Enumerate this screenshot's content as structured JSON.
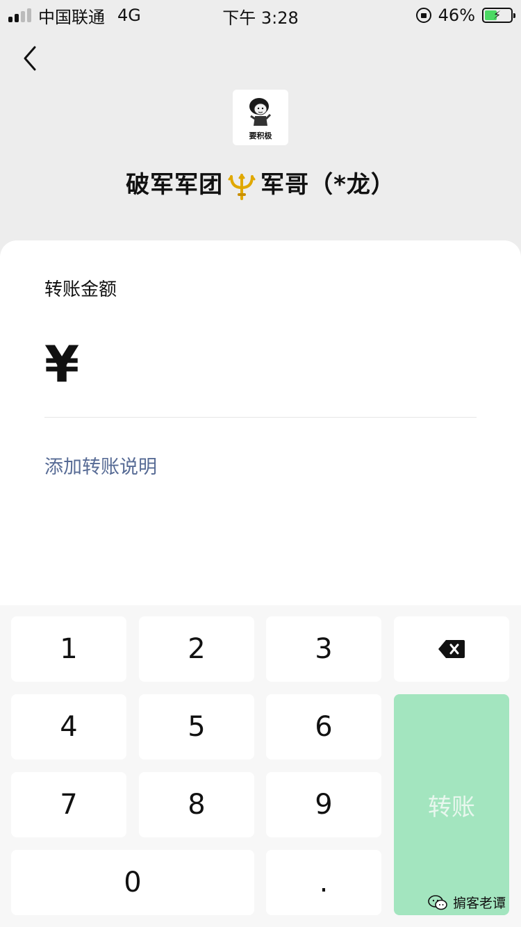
{
  "status_bar": {
    "carrier": "中国联通",
    "network": "4G",
    "time": "下午 3:28",
    "battery": "46%",
    "battery_level": 0.46
  },
  "header": {
    "avatar_caption": "要积极",
    "payee_prefix": "破军军团",
    "payee_emoji_icon": "trident-icon",
    "payee_suffix": "军哥（*龙）"
  },
  "transfer": {
    "amount_label": "转账金额",
    "currency_symbol": "¥",
    "add_note": "添加转账说明"
  },
  "keypad": {
    "keys": [
      "1",
      "2",
      "3",
      "4",
      "5",
      "6",
      "7",
      "8",
      "9",
      "0",
      "."
    ],
    "delete_icon": "backspace-icon",
    "transfer_label": "转账",
    "transfer_color": "#a3e5bf"
  },
  "watermark": {
    "icon": "wechat-icon",
    "text": "掮客老谭"
  },
  "colors": {
    "background": "#ededed",
    "link": "#576b95",
    "accent_disabled": "#a3e5bf"
  }
}
